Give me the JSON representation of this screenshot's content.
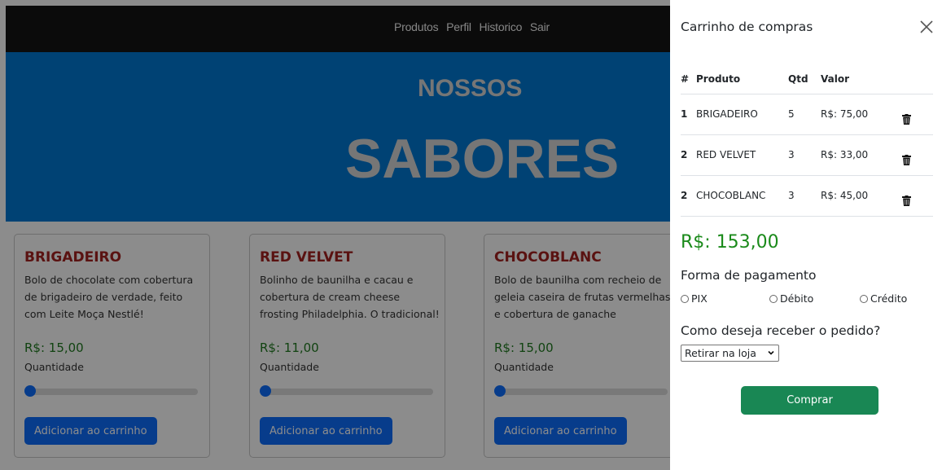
{
  "nav": {
    "links": [
      "Produtos",
      "Perfil",
      "Historico",
      "Sair"
    ]
  },
  "hero": {
    "line1": "NOSSOS",
    "line2": "SABORES"
  },
  "products": [
    {
      "name": "BRIGADEIRO",
      "description": "Bolo de chocolate com cobertura de brigadeiro de verdade, feito com Leite Moça Nestlé!",
      "price": "R$: 15,00",
      "qty_label": "Quantidade",
      "slider_value": 0,
      "add_label": "Adicionar ao carrinho"
    },
    {
      "name": "RED VELVET",
      "description": "Bolinho de baunilha e cacau e cobertura de cream cheese frosting Philadelphia. O tradicional!",
      "price": "R$: 11,00",
      "qty_label": "Quantidade",
      "slider_value": 0,
      "add_label": "Adicionar ao carrinho"
    },
    {
      "name": "CHOCOBLANC",
      "description": "Bolo de baunilha com recheio de geleia caseira de frutas vermelhas e cobertura de ganache",
      "price": "R$: 15,00",
      "qty_label": "Quantidade",
      "slider_value": 0,
      "add_label": "Adicionar ao carrinho"
    }
  ],
  "cart": {
    "title": "Carrinho de compras",
    "close_icon": "close-icon",
    "headers": {
      "n": "#",
      "product": "Produto",
      "qty": "Qtd",
      "value": "Valor"
    },
    "items": [
      {
        "n": "1",
        "product": "BRIGADEIRO",
        "qty": "5",
        "value": "R$: 75,00"
      },
      {
        "n": "2",
        "product": "RED VELVET",
        "qty": "3",
        "value": "R$: 33,00"
      },
      {
        "n": "2",
        "product": "CHOCOBLANC",
        "qty": "3",
        "value": "R$: 45,00"
      }
    ],
    "total": "R$: 153,00",
    "payment_title": "Forma de pagamento",
    "payment_options": [
      "PIX",
      "Débito",
      "Crédito"
    ],
    "delivery_title": "Como deseja receber o pedido?",
    "delivery_selected": "Retirar na loja",
    "buy_label": "Comprar"
  },
  "colors": {
    "accent_blue": "#0d6efd",
    "buy_green": "#198754",
    "product_title": "#a4211f",
    "total_green": "#1a8a1a"
  }
}
